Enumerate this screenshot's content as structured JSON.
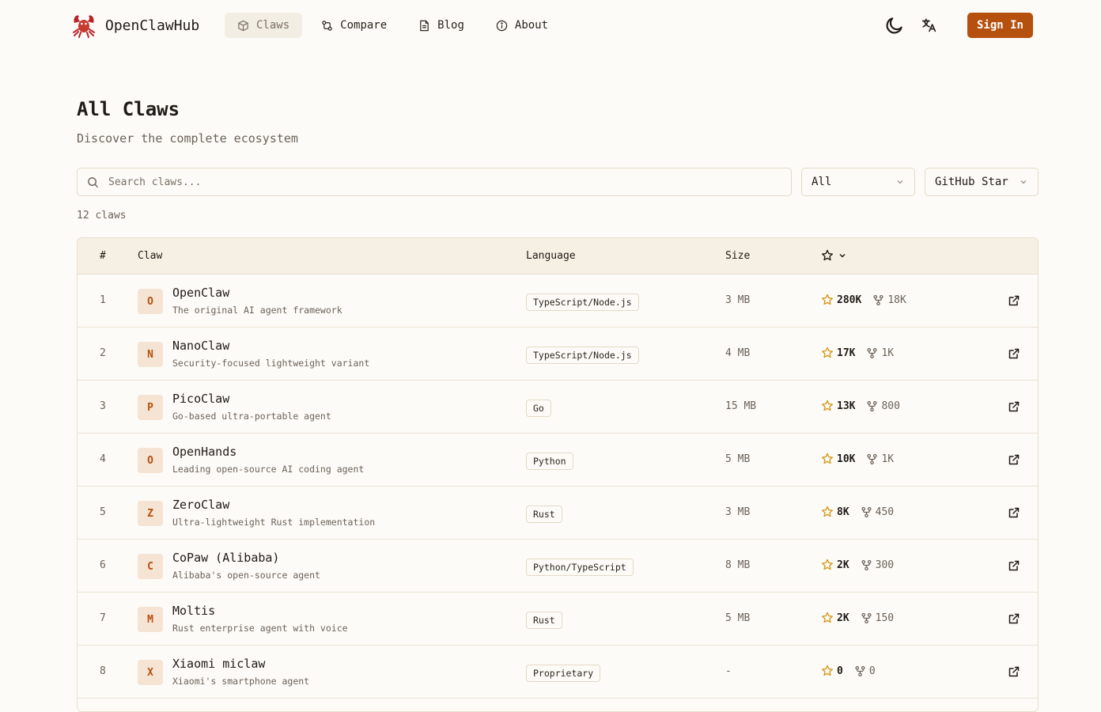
{
  "brand": {
    "name": "OpenClawHub"
  },
  "nav": [
    {
      "label": "Claws",
      "icon": "box-icon",
      "active": true
    },
    {
      "label": "Compare",
      "icon": "git-compare-icon",
      "active": false
    },
    {
      "label": "Blog",
      "icon": "file-text-icon",
      "active": false
    },
    {
      "label": "About",
      "icon": "info-icon",
      "active": false
    }
  ],
  "header": {
    "sign_in": "Sign In"
  },
  "page": {
    "title": "All Claws",
    "subtitle": "Discover the complete ecosystem"
  },
  "search": {
    "placeholder": "Search claws..."
  },
  "filters": {
    "category": "All",
    "sort": "GitHub Star"
  },
  "count_label": "12 claws",
  "table": {
    "headers": {
      "num": "#",
      "claw": "Claw",
      "language": "Language",
      "size": "Size"
    },
    "rows": [
      {
        "num": "1",
        "initial": "O",
        "name": "OpenClaw",
        "desc": "The original AI agent framework",
        "language": "TypeScript/Node.js",
        "size": "3 MB",
        "stars": "280K",
        "forks": "18K"
      },
      {
        "num": "2",
        "initial": "N",
        "name": "NanoClaw",
        "desc": "Security-focused lightweight variant",
        "language": "TypeScript/Node.js",
        "size": "4 MB",
        "stars": "17K",
        "forks": "1K"
      },
      {
        "num": "3",
        "initial": "P",
        "name": "PicoClaw",
        "desc": "Go-based ultra-portable agent",
        "language": "Go",
        "size": "15 MB",
        "stars": "13K",
        "forks": "800"
      },
      {
        "num": "4",
        "initial": "O",
        "name": "OpenHands",
        "desc": "Leading open-source AI coding agent",
        "language": "Python",
        "size": "5 MB",
        "stars": "10K",
        "forks": "1K"
      },
      {
        "num": "5",
        "initial": "Z",
        "name": "ZeroClaw",
        "desc": "Ultra-lightweight Rust implementation",
        "language": "Rust",
        "size": "3 MB",
        "stars": "8K",
        "forks": "450"
      },
      {
        "num": "6",
        "initial": "C",
        "name": "CoPaw (Alibaba)",
        "desc": "Alibaba's open-source agent",
        "language": "Python/TypeScript",
        "size": "8 MB",
        "stars": "2K",
        "forks": "300"
      },
      {
        "num": "7",
        "initial": "M",
        "name": "Moltis",
        "desc": "Rust enterprise agent with voice",
        "language": "Rust",
        "size": "5 MB",
        "stars": "2K",
        "forks": "150"
      },
      {
        "num": "8",
        "initial": "X",
        "name": "Xiaomi miclaw",
        "desc": "Xiaomi's smartphone agent",
        "language": "Proprietary",
        "size": "-",
        "stars": "0",
        "forks": "0"
      }
    ]
  },
  "colors": {
    "accent": "#b5500f",
    "star": "#d49a1f",
    "background": "#fdfbf7"
  }
}
